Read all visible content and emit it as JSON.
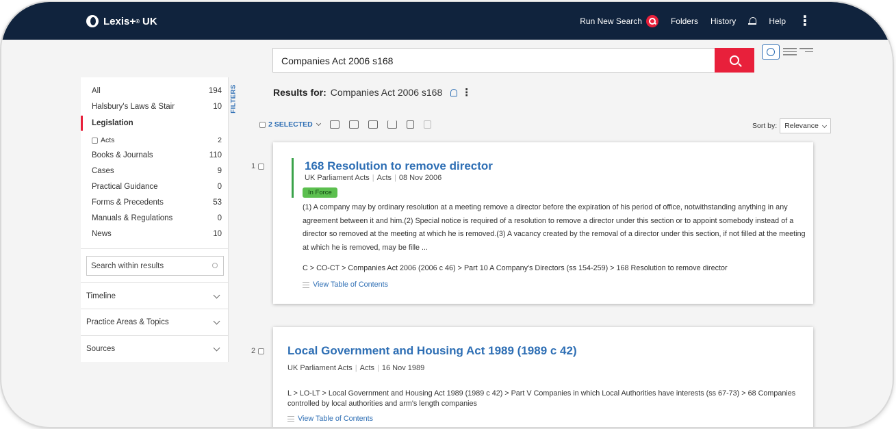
{
  "app": {
    "name": "Lexis+",
    "region": "UK",
    "reg": "®"
  },
  "nav": {
    "run_new_search": "Run New Search",
    "folders": "Folders",
    "history": "History",
    "help": "Help"
  },
  "search": {
    "query": "Companies Act 2006 s168"
  },
  "sidebar": {
    "facets": [
      {
        "label": "All",
        "count": "194"
      },
      {
        "label": "Halsbury's Laws & Stair",
        "count": "10"
      },
      {
        "label": "Legislation",
        "count": ""
      },
      {
        "label": "Acts",
        "count": "2"
      },
      {
        "label": "Books & Journals",
        "count": "110"
      },
      {
        "label": "Cases",
        "count": "9"
      },
      {
        "label": "Practical Guidance",
        "count": "0"
      },
      {
        "label": "Forms & Precedents",
        "count": "53"
      },
      {
        "label": "Manuals & Regulations",
        "count": "0"
      },
      {
        "label": "News",
        "count": "10"
      }
    ],
    "search_within_placeholder": "Search within results",
    "sections": [
      "Timeline",
      "Practice Areas & Topics",
      "Sources"
    ],
    "filters_tab": "FILTERS"
  },
  "results": {
    "results_for_label": "Results for:",
    "query": "Companies Act 2006 s168",
    "selected_label": "2 SELECTED",
    "sort_by_label": "Sort by:",
    "sort_value": "Relevance",
    "items": [
      {
        "number": "1",
        "title": "168 Resolution to remove director",
        "source": "UK Parliament Acts",
        "type": "Acts",
        "date": "08 Nov 2006",
        "status": "In Force",
        "snippet": "(1) A company may by ordinary resolution at a meeting remove a director before the expiration of his period of office, notwithstanding anything in any agreement between it and him.(2) Special notice is required of a resolution to remove a director under this section or to appoint somebody instead of a director so removed at the meeting at which he is removed.(3) A vacancy created by the removal of a director under this section, if not filled at the meeting at which he is removed, may be fille ...",
        "path": "C > CO-CT > Companies Act 2006 (2006 c 46) > Part 10 A Company's Directors (ss 154-259) > 168 Resolution to remove director",
        "toc_label": "View Table of Contents"
      },
      {
        "number": "2",
        "title": "Local Government and Housing Act 1989 (1989 c 42)",
        "source": "UK Parliament Acts",
        "type": "Acts",
        "date": "16 Nov 1989",
        "path": "L > LO-LT > Local Government and Housing Act 1989 (1989 c 42) > Part V Companies in which Local Authorities have interests (ss 67-73) > 68 Companies controlled by local authorities and arm's length companies",
        "toc_label": "View Table of Contents"
      }
    ]
  },
  "colors": {
    "nav_bg": "#10233d",
    "accent_red": "#e8203b",
    "link_blue": "#2d6eb4",
    "in_force_green": "#5cbf4f"
  }
}
